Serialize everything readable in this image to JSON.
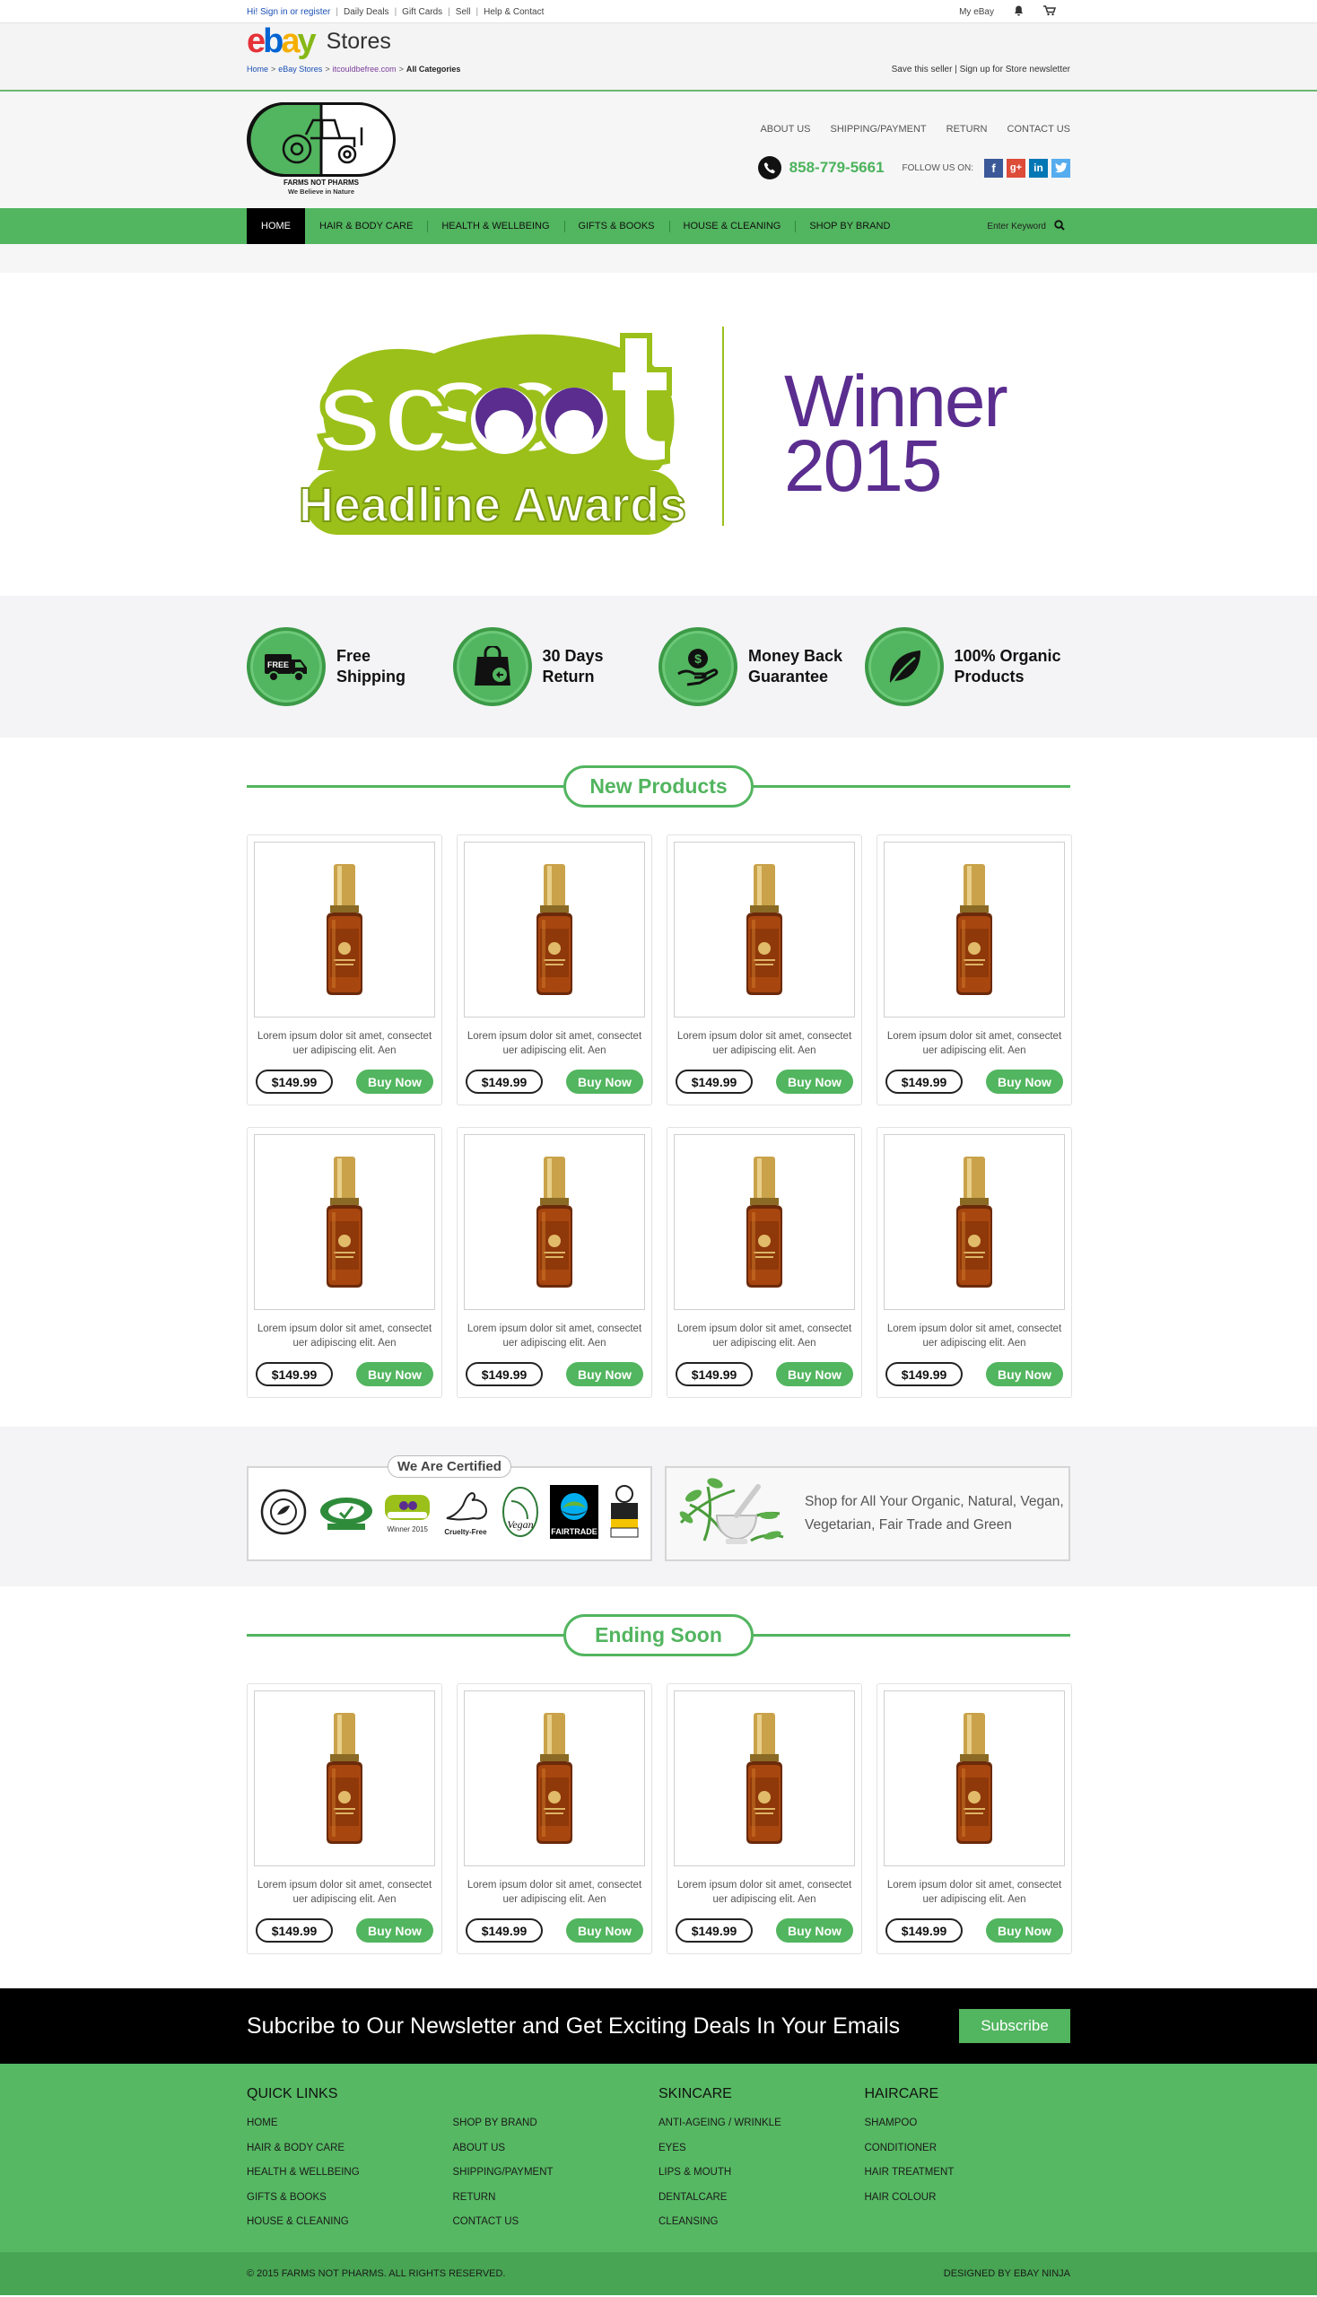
{
  "ebay": {
    "signin": "Hi! Sign in or register",
    "links": [
      "Daily Deals",
      "Gift Cards",
      "Sell",
      "Help & Contact"
    ],
    "my_ebay": "My eBay",
    "stores": "Stores",
    "breadcrumb": [
      "Home",
      "eBay Stores",
      "itcouldbefree.com",
      "All Categories"
    ],
    "save_seller": "Save this seller | Sign up for Store newsletter"
  },
  "header": {
    "logo_name": "FARMS NOT PHARMS",
    "logo_tagline": "We Believe in Nature",
    "toplinks": [
      "ABOUT US",
      "SHIPPING/PAYMENT",
      "RETURN",
      "CONTACT US"
    ],
    "phone": "858-779-5661",
    "follow": "FOLLOW US ON:",
    "social": [
      "f",
      "g+",
      "in",
      "t"
    ]
  },
  "nav": {
    "items": [
      "HOME",
      "HAIR & BODY CARE",
      "HEALTH & WELLBEING",
      "GIFTS & BOOKS",
      "HOUSE & CLEANING",
      "SHOP BY BRAND"
    ],
    "search_placeholder": "Enter Keyword"
  },
  "banner": {
    "logo_word": "scoot",
    "logo_sub": "Headline Awards",
    "winner": "Winner",
    "year": "2015"
  },
  "features": [
    {
      "line1": "Free",
      "line2": "Shipping",
      "icon": "truck-icon",
      "badge": "FREE"
    },
    {
      "line1": "30 Days",
      "line2": "Return",
      "icon": "shopping-bag-icon"
    },
    {
      "line1": "Money Back",
      "line2": "Guarantee",
      "icon": "money-hand-icon"
    },
    {
      "line1": "100% Organic",
      "line2": "Products",
      "icon": "leaf-icon"
    }
  ],
  "new_products": {
    "title": "New Products",
    "items": [
      {
        "desc": "Lorem ipsum dolor sit amet, consectet uer adipiscing elit. Aen",
        "price": "$149.99",
        "button": "Buy Now"
      },
      {
        "desc": "Lorem ipsum dolor sit amet, consectet uer adipiscing elit. Aen",
        "price": "$149.99",
        "button": "Buy Now"
      },
      {
        "desc": "Lorem ipsum dolor sit amet, consectet uer adipiscing elit. Aen",
        "price": "$149.99",
        "button": "Buy Now"
      },
      {
        "desc": "Lorem ipsum dolor sit amet, consectet uer adipiscing elit. Aen",
        "price": "$149.99",
        "button": "Buy Now"
      },
      {
        "desc": "Lorem ipsum dolor sit amet, consectet uer adipiscing elit. Aen",
        "price": "$149.99",
        "button": "Buy Now"
      },
      {
        "desc": "Lorem ipsum dolor sit amet, consectet uer adipiscing elit. Aen",
        "price": "$149.99",
        "button": "Buy Now"
      },
      {
        "desc": "Lorem ipsum dolor sit amet, consectet uer adipiscing elit. Aen",
        "price": "$149.99",
        "button": "Buy Now"
      },
      {
        "desc": "Lorem ipsum dolor sit amet, consectet uer adipiscing elit. Aen",
        "price": "$149.99",
        "button": "Buy Now"
      }
    ]
  },
  "certified": {
    "title": "We Are Certified",
    "badges": [
      "soil-association-organic-icon",
      "vegetarian-society-approved-icon",
      "scoot-winner-2015-icon",
      "cruelty-free-icon",
      "vegan-icon",
      "fairtrade-icon",
      "best-organic-product-icon"
    ],
    "scoot_caption": "Winner 2015",
    "cruelty_caption": "Cruelty-Free",
    "vegan_caption": "Vegan",
    "fairtrade_caption": "FAIRTRADE",
    "shop_text_1": "Shop for All Your Organic, Natural, Vegan,",
    "shop_text_2": "Vegetarian, Fair Trade and Green"
  },
  "ending_soon": {
    "title": "Ending Soon",
    "items": [
      {
        "desc": "Lorem ipsum dolor sit amet, consectet uer adipiscing elit. Aen",
        "price": "$149.99",
        "button": "Buy Now"
      },
      {
        "desc": "Lorem ipsum dolor sit amet, consectet uer adipiscing elit. Aen",
        "price": "$149.99",
        "button": "Buy Now"
      },
      {
        "desc": "Lorem ipsum dolor sit amet, consectet uer adipiscing elit. Aen",
        "price": "$149.99",
        "button": "Buy Now"
      },
      {
        "desc": "Lorem ipsum dolor sit amet, consectet uer adipiscing elit. Aen",
        "price": "$149.99",
        "button": "Buy Now"
      }
    ]
  },
  "newsletter": {
    "text": "Subcribe to Our Newsletter and Get Exciting Deals In Your Emails",
    "button": "Subscribe"
  },
  "footer": {
    "columns": [
      {
        "title": "QUICK LINKS",
        "links": [
          "HOME",
          "HAIR & BODY CARE",
          "HEALTH & WELLBEING",
          "GIFTS & BOOKS",
          "HOUSE & CLEANING"
        ]
      },
      {
        "title": "",
        "links": [
          "SHOP BY BRAND",
          "ABOUT US",
          "SHIPPING/PAYMENT",
          "RETURN",
          "CONTACT US"
        ]
      },
      {
        "title": "SKINCARE",
        "links": [
          "ANTI-AGEING / WRINKLE",
          "EYES",
          "LIPS & MOUTH",
          "DENTALCARE",
          "CLEANSING"
        ]
      },
      {
        "title": "HAIRCARE",
        "links": [
          "SHAMPOO",
          "CONDITIONER",
          "HAIR TREATMENT",
          "HAIR COLOUR"
        ]
      }
    ],
    "copyright": "© 2015 FARMS NOT PHARMS. ALL RIGHTS RESERVED.",
    "designed": "DESIGNED BY EBAY NINJA"
  },
  "colors": {
    "brand_green": "#52b55f",
    "winner_purple": "#5a2d8f",
    "scoot_lime": "#9bc01a"
  }
}
